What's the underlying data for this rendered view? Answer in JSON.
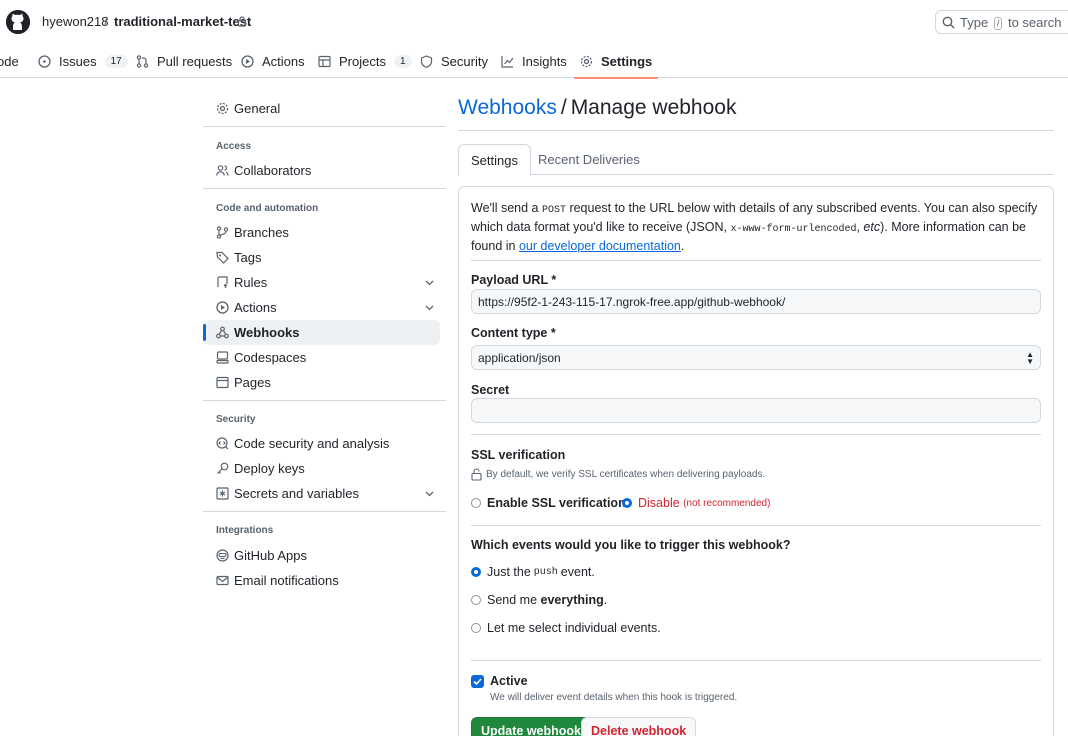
{
  "header": {
    "owner": "hyewon218",
    "separator": "/",
    "repo": "traditional-market-test",
    "search": {
      "pre": "Type",
      "key": "/",
      "post": "to search"
    }
  },
  "repo_nav": [
    {
      "label": "ode",
      "icon": "code-icon",
      "counter": ""
    },
    {
      "label": "Issues",
      "icon": "issue-icon",
      "counter": "17"
    },
    {
      "label": "Pull requests",
      "icon": "pull-request-icon",
      "counter": ""
    },
    {
      "label": "Actions",
      "icon": "play-icon",
      "counter": ""
    },
    {
      "label": "Projects",
      "icon": "table-icon",
      "counter": "1"
    },
    {
      "label": "Security",
      "icon": "shield-icon",
      "counter": ""
    },
    {
      "label": "Insights",
      "icon": "graph-icon",
      "counter": ""
    },
    {
      "label": "Settings",
      "icon": "gear-icon",
      "counter": "",
      "selected": true
    }
  ],
  "sidebar": {
    "general": "General",
    "access_heading": "Access",
    "collaborators": "Collaborators",
    "code_heading": "Code and automation",
    "branches": "Branches",
    "tags": "Tags",
    "rules": "Rules",
    "actions": "Actions",
    "webhooks": "Webhooks",
    "codespaces": "Codespaces",
    "pages": "Pages",
    "security_heading": "Security",
    "code_security": "Code security and analysis",
    "deploy_keys": "Deploy keys",
    "secrets": "Secrets and variables",
    "integrations_heading": "Integrations",
    "github_apps": "GitHub Apps",
    "email_notifications": "Email notifications"
  },
  "main": {
    "title_link": "Webhooks",
    "title_sep": "/",
    "title_rest": "Manage webhook",
    "tabs": {
      "settings": "Settings",
      "deliveries": "Recent Deliveries"
    },
    "intro": {
      "p1": "We'll send a ",
      "post": "POST",
      "p2": " request to the URL below with details of any subscribed events. You can also specify which data format you'd like to receive (JSON, ",
      "form": "x-www-form-urlencoded",
      "p3": ", ",
      "etc": "etc",
      "p4": "). More information can be found in ",
      "link": "our developer documentation",
      "p5": "."
    },
    "payload_label": "Payload URL",
    "payload_value": "https://95f2-1-243-115-17.ngrok-free.app/github-webhook/",
    "content_type_label": "Content type",
    "content_type_value": "application/json",
    "required_mark": "*",
    "secret_label": "Secret",
    "secret_value": "",
    "ssl": {
      "label": "SSL verification",
      "note": "By default, we verify SSL certificates when delivering payloads.",
      "enable": "Enable SSL verification",
      "disable": "Disable",
      "disable_note": "(not recommended)"
    },
    "events": {
      "question": "Which events would you like to trigger this webhook?",
      "just_pre": "Just the",
      "just_code": "push",
      "just_post": "event.",
      "send_pre": "Send me",
      "send_bold": "everything",
      "send_post": ".",
      "select": "Let me select individual events."
    },
    "active": {
      "label": "Active",
      "note": "We will deliver event details when this hook is triggered."
    },
    "buttons": {
      "update": "Update webhook",
      "delete": "Delete webhook"
    }
  }
}
